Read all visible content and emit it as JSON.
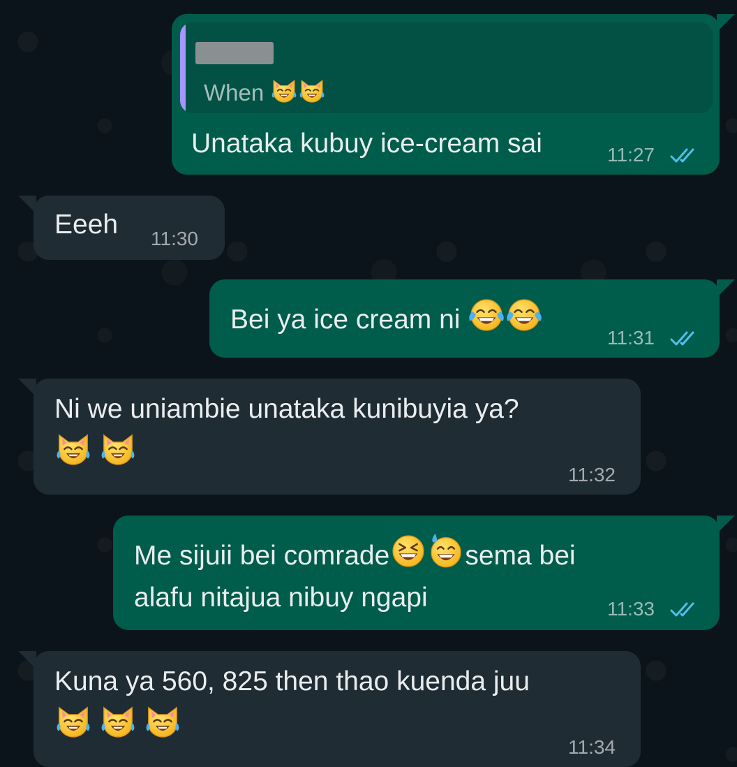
{
  "messages": [
    {
      "direction": "outgoing",
      "reply": {
        "author": "",
        "text": "When",
        "emoji": [
          "cat-tears-of-joy",
          "cat-tears-of-joy"
        ]
      },
      "text": "Unataka kubuy ice-cream sai",
      "time": "11:27",
      "status": "read"
    },
    {
      "direction": "incoming",
      "text": "Eeeh",
      "time": "11:30"
    },
    {
      "direction": "outgoing",
      "text": "Bei ya ice cream ni",
      "emoji": [
        "face-with-tears-of-joy",
        "face-with-tears-of-joy"
      ],
      "time": "11:31",
      "status": "read"
    },
    {
      "direction": "incoming",
      "text": "Ni we uniambie unataka kunibuyia ya?",
      "emoji": [
        "cat-tears-of-joy",
        "cat-tears-of-joy"
      ],
      "time": "11:32"
    },
    {
      "direction": "outgoing",
      "text_part1": "Me sijuii bei comrade",
      "emoji": [
        "grinning-squinting-face",
        "grinning-face-with-sweat"
      ],
      "text_part2": "sema bei",
      "text_line2": "alafu nitajua nibuy ngapi",
      "time": "11:33",
      "status": "read"
    },
    {
      "direction": "incoming",
      "text": "Kuna ya 560, 825 then thao kuenda juu",
      "emoji": [
        "cat-tears-of-joy",
        "cat-tears-of-joy",
        "cat-tears-of-joy"
      ],
      "time": "11:34"
    }
  ],
  "colors": {
    "background": "#0b141a",
    "outgoing_bubble": "#005c4b",
    "incoming_bubble": "#202c33",
    "read_ticks": "#53bdeb",
    "quote_bar": "#a694ff"
  }
}
